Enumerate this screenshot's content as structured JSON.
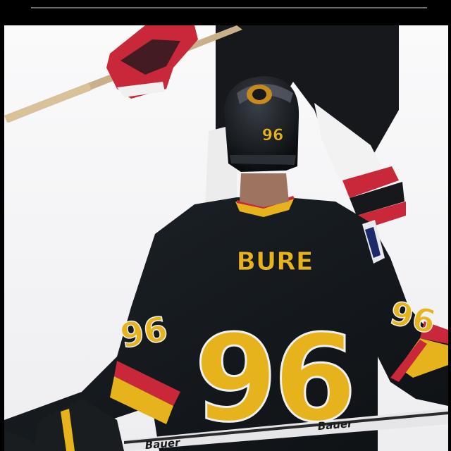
{
  "photo": {
    "jersey": {
      "name": "BURE",
      "number": "96",
      "sleeve_number": "96",
      "helmet_number": "96"
    },
    "stick_brand": "Bauer",
    "colors": {
      "ice": "#f4f4f6",
      "jersey": "#14181c",
      "gold": "#e6b31c",
      "red": "#c8283a",
      "white_trim": "#f0f0f0"
    }
  }
}
